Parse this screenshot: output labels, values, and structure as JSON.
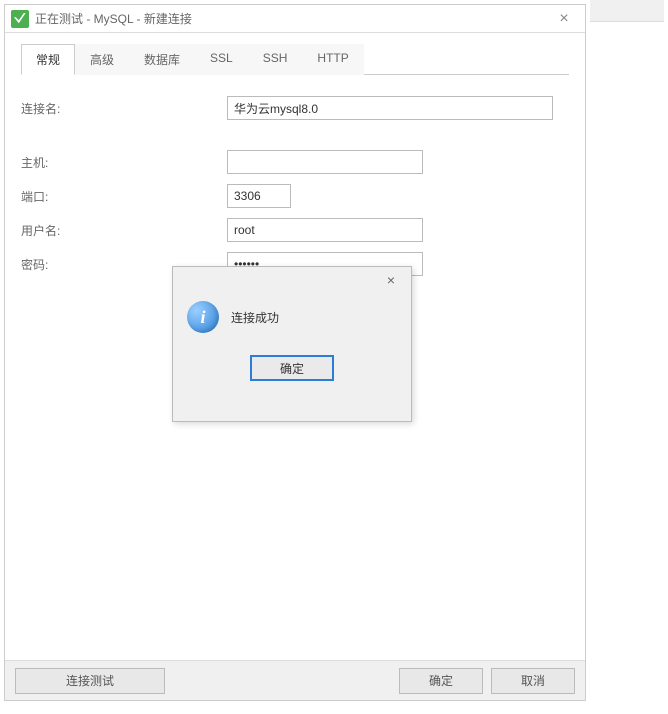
{
  "window": {
    "title": "正在测试 - MySQL - 新建连接"
  },
  "tabs": {
    "items": [
      "常规",
      "高级",
      "数据库",
      "SSL",
      "SSH",
      "HTTP"
    ],
    "active_index": 0
  },
  "form": {
    "conn_name_label": "连接名:",
    "conn_name_value": "华为云mysql8.0",
    "host_label": "主机:",
    "host_value": "",
    "port_label": "端口:",
    "port_value": "3306",
    "user_label": "用户名:",
    "user_value": "root",
    "pass_label": "密码:",
    "pass_value": "••••••"
  },
  "footer": {
    "test_label": "连接测试",
    "ok_label": "确定",
    "cancel_label": "取消"
  },
  "modal": {
    "message": "连接成功",
    "ok_label": "确定"
  }
}
